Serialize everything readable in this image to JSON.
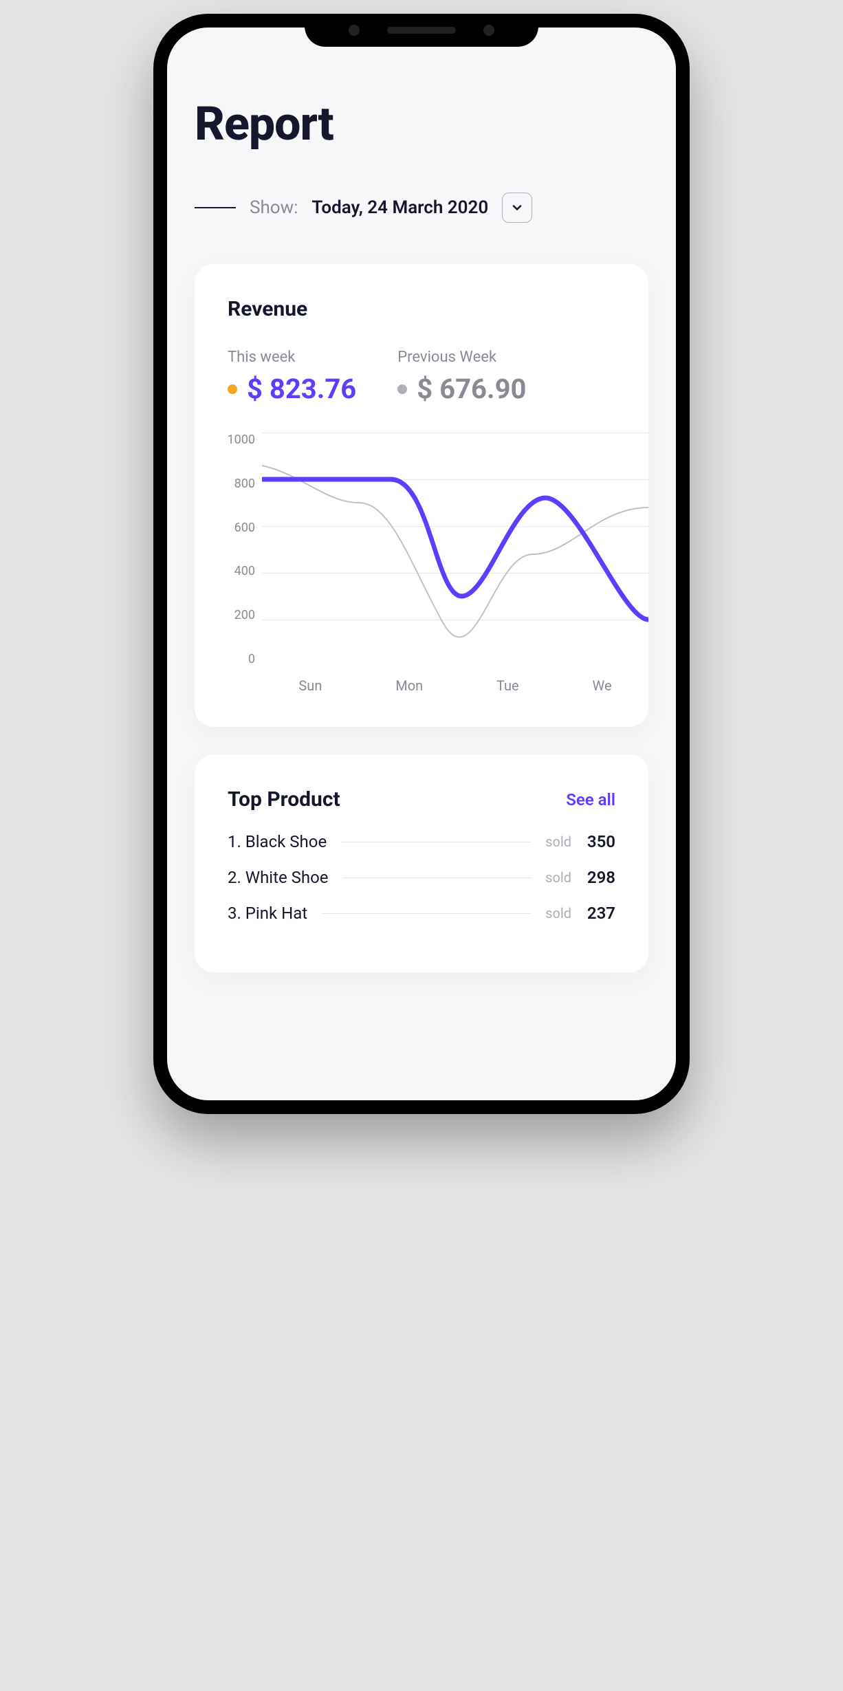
{
  "header": {
    "title": "Report",
    "show_label": "Show:",
    "show_value": "Today, 24 March 2020"
  },
  "revenue": {
    "title": "Revenue",
    "this_week": {
      "label": "This week",
      "value": "$ 823.76"
    },
    "previous_week": {
      "label": "Previous Week",
      "value": "$ 676.90"
    }
  },
  "chart_data": {
    "type": "line",
    "ylim": [
      0,
      1000
    ],
    "yticks": [
      "1000",
      "800",
      "600",
      "400",
      "200",
      "0"
    ],
    "categories": [
      "Sun",
      "Mon",
      "Tue",
      "We"
    ],
    "series": [
      {
        "name": "This week",
        "color": "#5b3fff",
        "values": [
          800,
          800,
          300,
          720,
          200
        ]
      },
      {
        "name": "Previous Week",
        "color": "#c0c0c8",
        "values": [
          860,
          700,
          440,
          190,
          480,
          680
        ]
      }
    ]
  },
  "top_product": {
    "title": "Top Product",
    "see_all": "See all",
    "sold_label": "sold",
    "items": [
      {
        "label": "1. Black Shoe",
        "count": "350"
      },
      {
        "label": "2. White Shoe",
        "count": "298"
      },
      {
        "label": "3. Pink Hat",
        "count": "237"
      }
    ]
  }
}
